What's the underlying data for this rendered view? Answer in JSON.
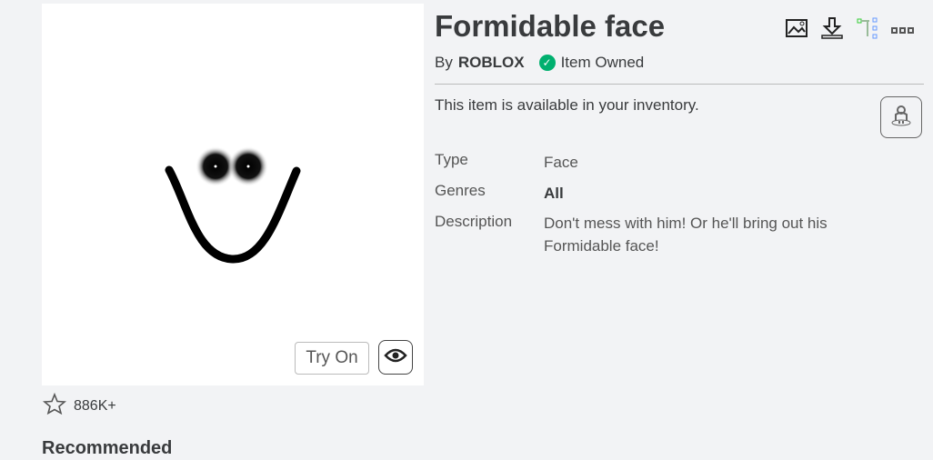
{
  "item": {
    "title": "Formidable face",
    "by_prefix": "By",
    "creator": "ROBLOX",
    "owned": "Item Owned",
    "availability": "This item is available in your inventory.",
    "favorites": "886K+",
    "try_on": "Try On"
  },
  "details": [
    {
      "label": "Type",
      "value": "Face"
    },
    {
      "label": "Genres",
      "value": "All"
    },
    {
      "label": "Description",
      "value": "Don't mess with him! Or he'll bring out his Formidable face!"
    }
  ],
  "recommended": "Recommended"
}
